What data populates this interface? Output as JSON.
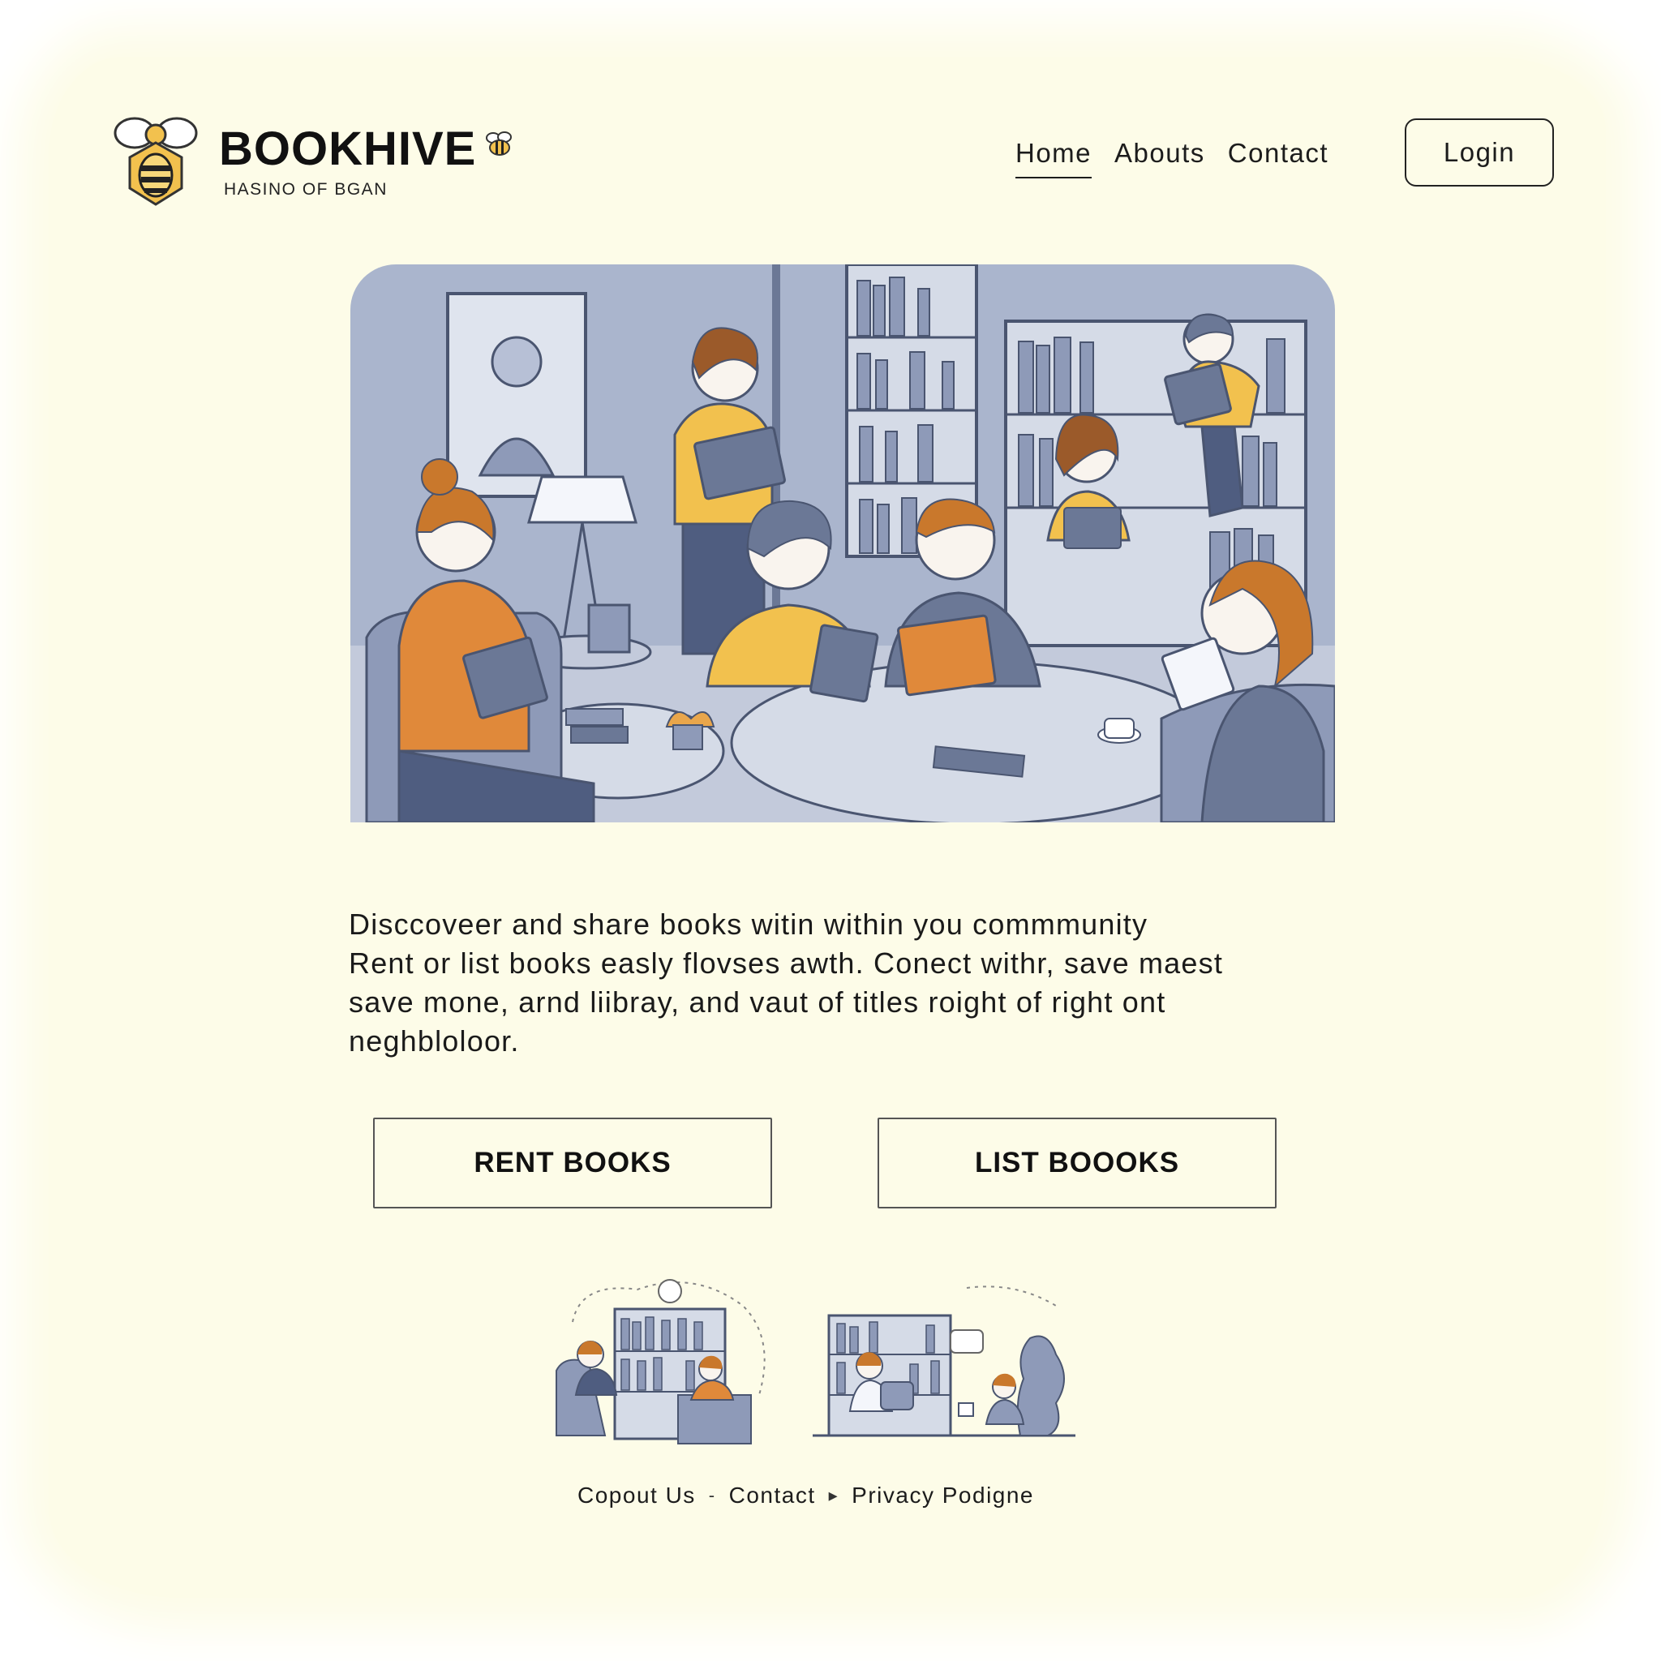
{
  "brand": {
    "name": "BOOKHIVE",
    "tagline": "HASINO OF BGAN"
  },
  "nav": {
    "items": [
      {
        "label": "Home",
        "active": true
      },
      {
        "label": "Abouts"
      },
      {
        "label": "Contact"
      }
    ],
    "login_label": "Login"
  },
  "hero": {
    "description_lines": [
      "Disccoveer and share  books witin within you commmunity",
      "Rent or list books easly flovses awth.  Conect withr, save maest",
      "save mone, arnd liibray, and vaut of titles roight of right ont",
      "neghbloloor."
    ]
  },
  "actions": {
    "rent_label": "RENT BOOKS",
    "list_label": "LIST BOOOKS"
  },
  "footer": {
    "links": [
      "Copout Us",
      "Contact",
      "Privacy Podigne"
    ],
    "separators": [
      "-",
      "▸"
    ]
  },
  "colors": {
    "background": "#fdfce8",
    "illustration_blue": "#a9b4cc",
    "accent_yellow": "#f5c85a",
    "accent_orange": "#d98a3a",
    "text": "#1c1c1c"
  },
  "icons": {
    "logo": "bee-hive-logo-icon",
    "brand_mark": "small-bee-icon"
  }
}
